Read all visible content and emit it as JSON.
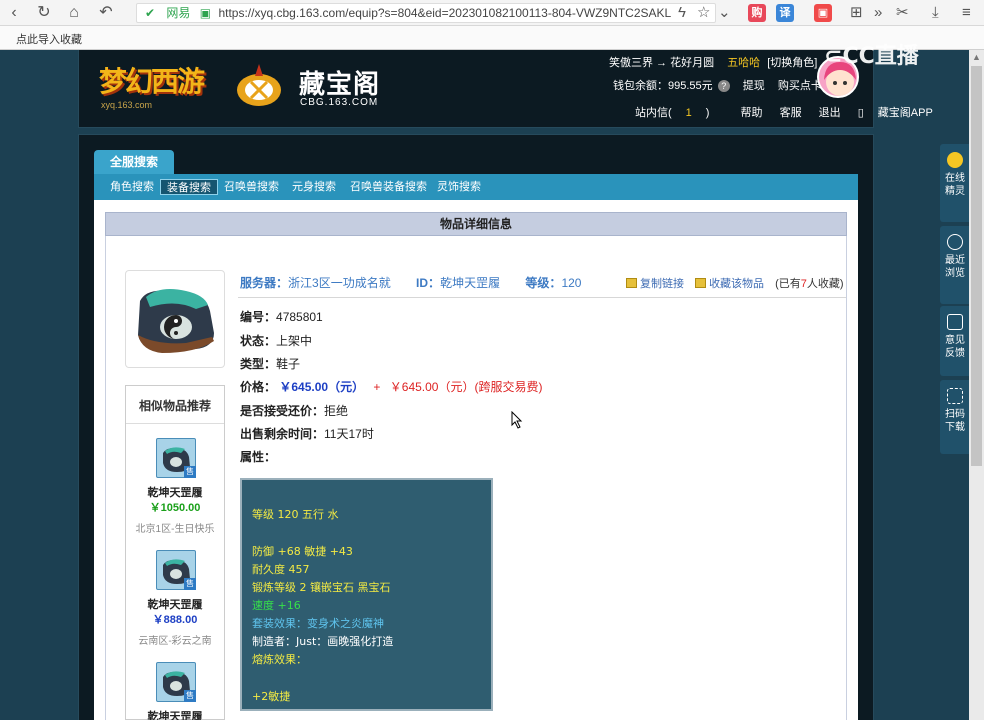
{
  "browser": {
    "safe_label": "网易",
    "url": "https://xyq.cbg.163.com/equip?s=804&eid=202301082100113-804-VWZ9NTC2SAKL",
    "ext_icons": [
      "购",
      "译"
    ],
    "favorites_bar_text": "点此导入收藏"
  },
  "header": {
    "game_logo_text": "梦幻西游",
    "game_logo_sub": "xyq.163.com",
    "cbg_logo_text": "藏宝阁",
    "cbg_logo_sub": "CBG.163.COM",
    "server_route": "笑傲三界 → 花好月圆",
    "char_name": "五哈哈",
    "switch_role": "[切换角色]",
    "wallet_label": "钱包余额：995.55元",
    "withdraw": "提现",
    "buy_points": "购买点卡",
    "links": {
      "inbox": "站内信(",
      "inbox_count": "1",
      "inbox_close": ")",
      "help": "帮助",
      "service": "客服",
      "logout": "退出",
      "app": "藏宝阁APP"
    }
  },
  "watermark": "CC直播",
  "tabs": {
    "all_search": "全服搜索",
    "subnav": [
      "角色搜索",
      "装备搜索",
      "召唤兽搜索",
      "元身搜索",
      "召唤兽装备搜索",
      "灵饰搜索"
    ],
    "active_index": 1
  },
  "detail": {
    "title": "物品详细信息",
    "server_label": "服务器：",
    "server_value": "浙江3区一功成名就",
    "id_label": "ID：",
    "id_value": "乾坤天罡履",
    "level_label": "等级：",
    "level_value": "120",
    "copy_link": "复制链接",
    "collect": "收藏该物品",
    "fav_count_pre": "(已有",
    "fav_count_num": "7",
    "fav_count_post": "人收藏)",
    "fields": {
      "serial_k": "编号：",
      "serial_v": "4785801",
      "status_k": "状态：",
      "status_v": "上架中",
      "type_k": "类型：",
      "type_v": "鞋子",
      "price_k": "价格：",
      "price_v": "￥645.00（元）",
      "plus": "+",
      "fee_v": "￥645.00（元）(跨服交易费)",
      "bargain_k": "是否接受还价：",
      "bargain_v": "拒绝",
      "remaining_k": "出售剩余时间：",
      "remaining_v": "11天17时",
      "attr_k": "属性："
    },
    "attributes": [
      {
        "text": "等级 120 五行 水",
        "color": "yellow"
      },
      {
        "text": "防御 +68 敏捷 +43",
        "color": "yellow"
      },
      {
        "text": "耐久度 457",
        "color": "yellow"
      },
      {
        "text": "锻炼等级 2 镶嵌宝石 黑宝石",
        "color": "yellow"
      },
      {
        "text": "速度 +16",
        "color": "green"
      },
      {
        "text": "套装效果：变身术之炎魔神",
        "color": "blue"
      },
      {
        "text": "制造者：Just：画晚强化打造",
        "color": "white"
      },
      {
        "text": "熔炼效果：",
        "color": "yellow"
      },
      {
        "text": "+2敏捷",
        "color": "yellow"
      }
    ]
  },
  "similar": {
    "title": "相似物品推荐",
    "items": [
      {
        "name": "乾坤天罡履",
        "price": "￥1050.00",
        "server": "北京1区-生日快乐",
        "price_color": "green"
      },
      {
        "name": "乾坤天罡履",
        "price": "￥888.00",
        "server": "云南区-彩云之南",
        "price_color": "blue"
      },
      {
        "name": "乾坤天罡履",
        "price": "",
        "server": "",
        "price_color": "blue"
      }
    ],
    "tag": "售"
  },
  "sidebar": [
    {
      "label1": "在线",
      "label2": "精灵"
    },
    {
      "label1": "最近",
      "label2": "浏览"
    },
    {
      "label1": "意见",
      "label2": "反馈"
    },
    {
      "label1": "扫码",
      "label2": "下载"
    }
  ]
}
